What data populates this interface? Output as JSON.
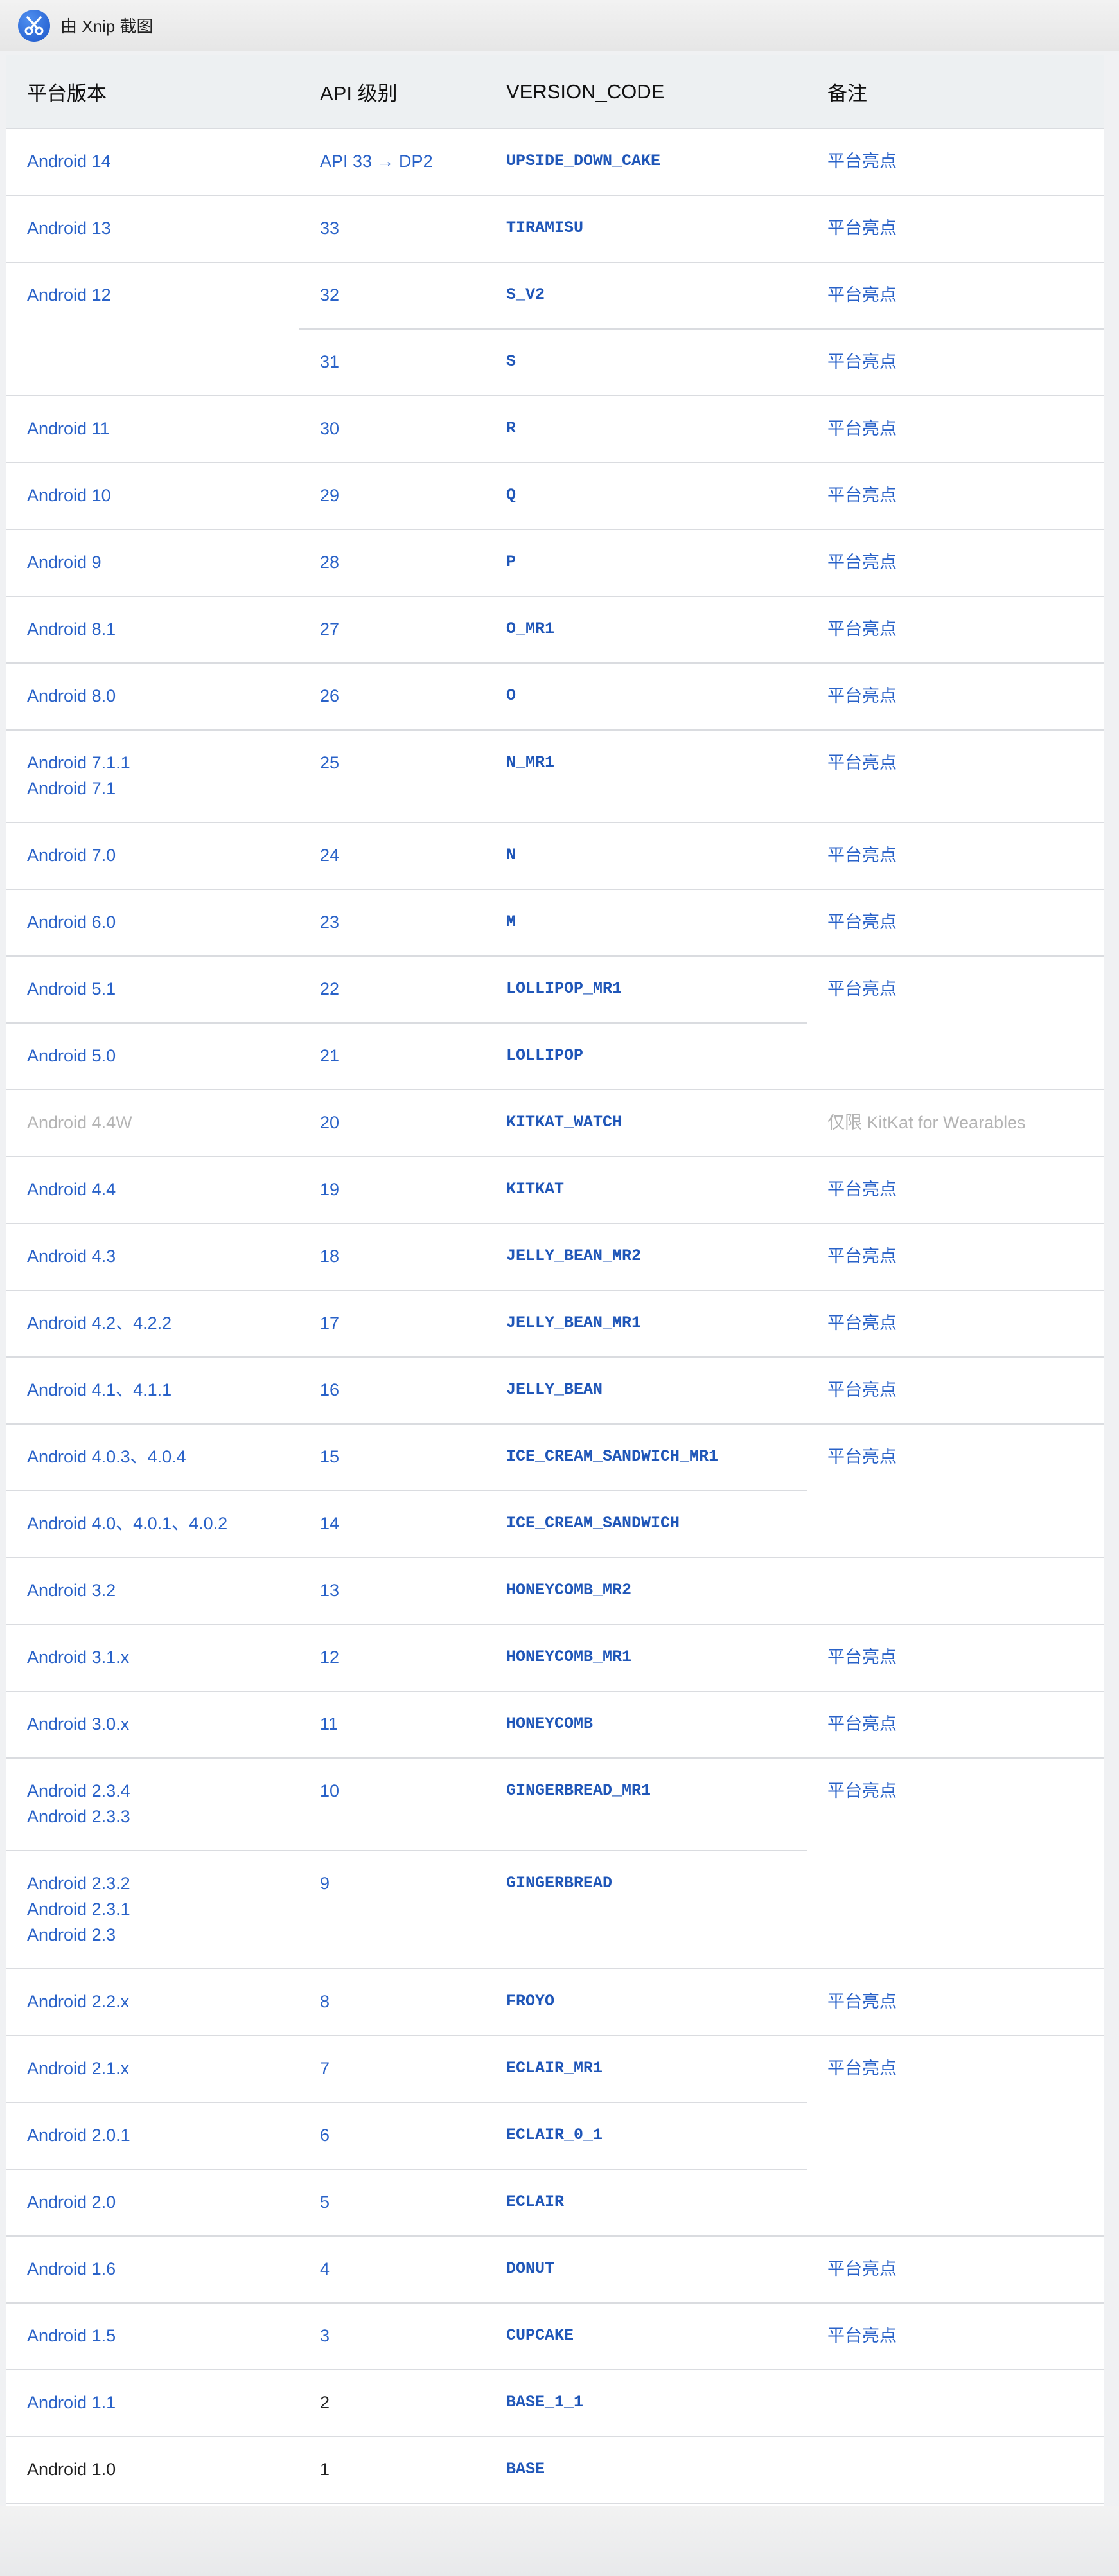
{
  "window": {
    "title": "由 Xnip 截图",
    "logo_icon": "xnip-scissors-icon"
  },
  "colors": {
    "link": "#2962c8",
    "code": "#1f56b8",
    "muted": "#b4b4b4",
    "header_bg": "#edf0f2"
  },
  "table": {
    "headers": {
      "platform": "平台版本",
      "api": "API 级别",
      "code": "VERSION_CODE",
      "notes": "备注"
    },
    "highlight": "平台亮点",
    "kitkat_watch_note": "仅限 KitKat for Wearables",
    "rows": [
      {
        "platform": [
          "Android 14"
        ],
        "api": "API 33 → DP2",
        "code": "UPSIDE_DOWN_CAKE",
        "note": "平台亮点"
      },
      {
        "platform": [
          "Android 13"
        ],
        "api": "33",
        "code": "TIRAMISU",
        "note": "平台亮点"
      },
      {
        "platform": [
          "Android 12"
        ],
        "api": "32",
        "code": "S_V2",
        "note": "平台亮点"
      },
      {
        "platform": [],
        "api": "31",
        "code": "S",
        "note": "平台亮点"
      },
      {
        "platform": [
          "Android 11"
        ],
        "api": "30",
        "code": "R",
        "note": "平台亮点"
      },
      {
        "platform": [
          "Android 10"
        ],
        "api": "29",
        "code": "Q",
        "note": "平台亮点"
      },
      {
        "platform": [
          "Android 9"
        ],
        "api": "28",
        "code": "P",
        "note": "平台亮点"
      },
      {
        "platform": [
          "Android 8.1"
        ],
        "api": "27",
        "code": "O_MR1",
        "note": "平台亮点"
      },
      {
        "platform": [
          "Android 8.0"
        ],
        "api": "26",
        "code": "O",
        "note": "平台亮点"
      },
      {
        "platform": [
          "Android 7.1.1",
          "Android 7.1"
        ],
        "api": "25",
        "code": "N_MR1",
        "note": "平台亮点"
      },
      {
        "platform": [
          "Android 7.0"
        ],
        "api": "24",
        "code": "N",
        "note": "平台亮点"
      },
      {
        "platform": [
          "Android 6.0"
        ],
        "api": "23",
        "code": "M",
        "note": "平台亮点"
      },
      {
        "platform": [
          "Android 5.1"
        ],
        "api": "22",
        "code": "LOLLIPOP_MR1",
        "note": "平台亮点"
      },
      {
        "platform": [
          "Android 5.0"
        ],
        "api": "21",
        "code": "LOLLIPOP",
        "note": ""
      },
      {
        "platform": [
          "Android 4.4W"
        ],
        "api": "20",
        "code": "KITKAT_WATCH",
        "note": "仅限 KitKat for Wearables",
        "muted": true
      },
      {
        "platform": [
          "Android 4.4"
        ],
        "api": "19",
        "code": "KITKAT",
        "note": "平台亮点"
      },
      {
        "platform": [
          "Android 4.3"
        ],
        "api": "18",
        "code": "JELLY_BEAN_MR2",
        "note": "平台亮点"
      },
      {
        "platform": [
          "Android 4.2、4.2.2"
        ],
        "api": "17",
        "code": "JELLY_BEAN_MR1",
        "note": "平台亮点"
      },
      {
        "platform": [
          "Android 4.1、4.1.1"
        ],
        "api": "16",
        "code": "JELLY_BEAN",
        "note": "平台亮点"
      },
      {
        "platform": [
          "Android 4.0.3、4.0.4"
        ],
        "api": "15",
        "code": "ICE_CREAM_SANDWICH_MR1",
        "note": "平台亮点"
      },
      {
        "platform": [
          "Android 4.0、4.0.1、4.0.2"
        ],
        "api": "14",
        "code": "ICE_CREAM_SANDWICH",
        "note": ""
      },
      {
        "platform": [
          "Android 3.2"
        ],
        "api": "13",
        "code": "HONEYCOMB_MR2",
        "note": ""
      },
      {
        "platform": [
          "Android 3.1.x"
        ],
        "api": "12",
        "code": "HONEYCOMB_MR1",
        "note": "平台亮点"
      },
      {
        "platform": [
          "Android 3.0.x"
        ],
        "api": "11",
        "code": "HONEYCOMB",
        "note": "平台亮点"
      },
      {
        "platform": [
          "Android 2.3.4",
          "Android 2.3.3"
        ],
        "api": "10",
        "code": "GINGERBREAD_MR1",
        "note": "平台亮点"
      },
      {
        "platform": [
          "Android 2.3.2",
          "Android 2.3.1",
          "Android 2.3"
        ],
        "api": "9",
        "code": "GINGERBREAD",
        "note": ""
      },
      {
        "platform": [
          "Android 2.2.x"
        ],
        "api": "8",
        "code": "FROYO",
        "note": "平台亮点"
      },
      {
        "platform": [
          "Android 2.1.x"
        ],
        "api": "7",
        "code": "ECLAIR_MR1",
        "note": "平台亮点"
      },
      {
        "platform": [
          "Android 2.0.1"
        ],
        "api": "6",
        "code": "ECLAIR_0_1",
        "note": ""
      },
      {
        "platform": [
          "Android 2.0"
        ],
        "api": "5",
        "code": "ECLAIR",
        "note": ""
      },
      {
        "platform": [
          "Android 1.6"
        ],
        "api": "4",
        "code": "DONUT",
        "note": "平台亮点"
      },
      {
        "platform": [
          "Android 1.5"
        ],
        "api": "3",
        "code": "CUPCAKE",
        "note": "平台亮点"
      },
      {
        "platform": [
          "Android 1.1"
        ],
        "api": "2",
        "code": "BASE_1_1",
        "note": "",
        "api_plain": true
      },
      {
        "platform": [
          "Android 1.0"
        ],
        "api": "1",
        "code": "BASE",
        "note": "",
        "platform_plain": true,
        "api_plain": true
      }
    ]
  }
}
